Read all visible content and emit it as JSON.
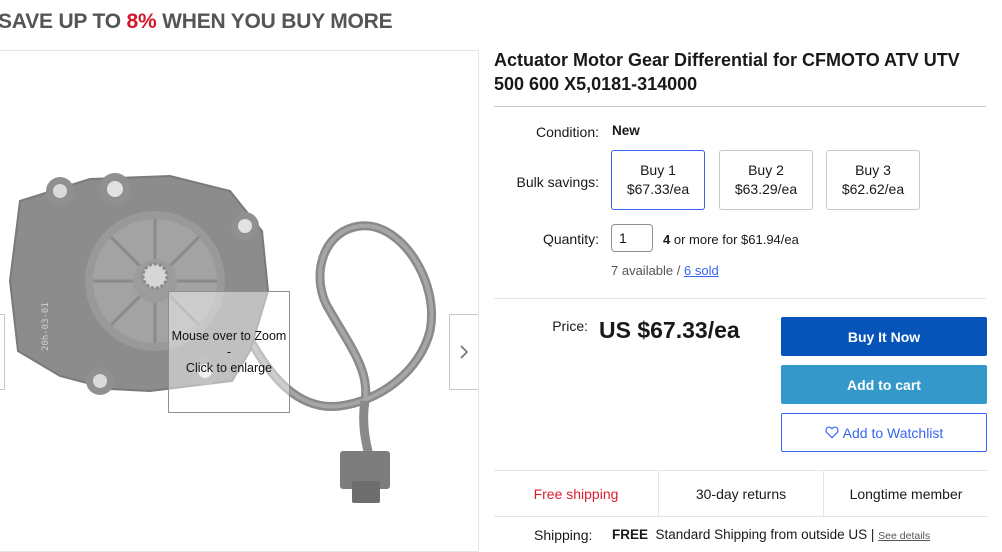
{
  "promo": {
    "prefix": "SAVE UP TO ",
    "percent": "8%",
    "suffix": " WHEN YOU BUY MORE"
  },
  "gallery": {
    "zoom_line1": "Mouse over to Zoom",
    "zoom_line2": "-",
    "zoom_line3": "Click to enlarge",
    "next_icon": "chevron-right-icon"
  },
  "product": {
    "title": "Actuator Motor Gear Differential for CFMOTO ATV UTV 500 600 X5,0181-314000",
    "condition_label": "Condition:",
    "condition_value": "New",
    "bulk_label": "Bulk savings:",
    "bulk_options": [
      {
        "line1": "Buy 1",
        "line2": "$67.33/ea"
      },
      {
        "line1": "Buy 2",
        "line2": "$63.29/ea"
      },
      {
        "line1": "Buy 3",
        "line2": "$62.62/ea"
      }
    ],
    "quantity_label": "Quantity:",
    "quantity_value": "1",
    "qty_note_count": "4",
    "qty_note_rest": " or more for $61.94/ea",
    "available": "7 available / ",
    "sold": "6 sold",
    "price_label": "Price:",
    "price": "US $67.33/ea"
  },
  "actions": {
    "buy_now": "Buy It Now",
    "add_to_cart": "Add to cart",
    "watch_icon": "heart-icon",
    "watchlist": "Add to Watchlist"
  },
  "features": [
    "Free shipping",
    "30-day returns",
    "Longtime member"
  ],
  "shipping": {
    "label": "Shipping:",
    "free": "FREE",
    "details": "Standard Shipping from outside US | ",
    "see_details": "See details"
  },
  "colors": {
    "accent": "#3665f3",
    "buy_now": "#0654ba",
    "add_to_cart": "#3498ca",
    "promo_red": "#d1182d",
    "free_shipping": "#dd1e31"
  }
}
